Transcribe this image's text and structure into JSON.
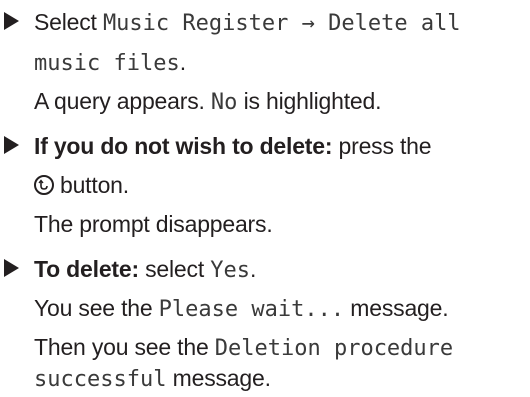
{
  "steps": [
    {
      "line1": {
        "prefix": "Select",
        "mono": "Music Register → Delete all"
      },
      "line2": {
        "mono": "music files",
        "suffix": "."
      },
      "line3": {
        "prefix": "A query appears.",
        "mono": "No",
        "suffix": "is highlighted."
      }
    },
    {
      "line1": {
        "bold": "If you do not wish to delete:",
        "suffix": "press the"
      },
      "line2": {
        "icon": "back-button-icon",
        "suffix": "button."
      },
      "line3": {
        "text": "The prompt disappears."
      }
    },
    {
      "line1": {
        "bold": "To delete:",
        "prefix": "select",
        "mono": "Yes",
        "suffix": "."
      },
      "line2": {
        "prefix": "You see the",
        "mono": "Please wait...",
        "suffix": "message."
      },
      "line3": {
        "prefix": "Then you see the",
        "mono": "Deletion procedure"
      },
      "line4": {
        "mono": "successful",
        "suffix": "message."
      }
    }
  ]
}
